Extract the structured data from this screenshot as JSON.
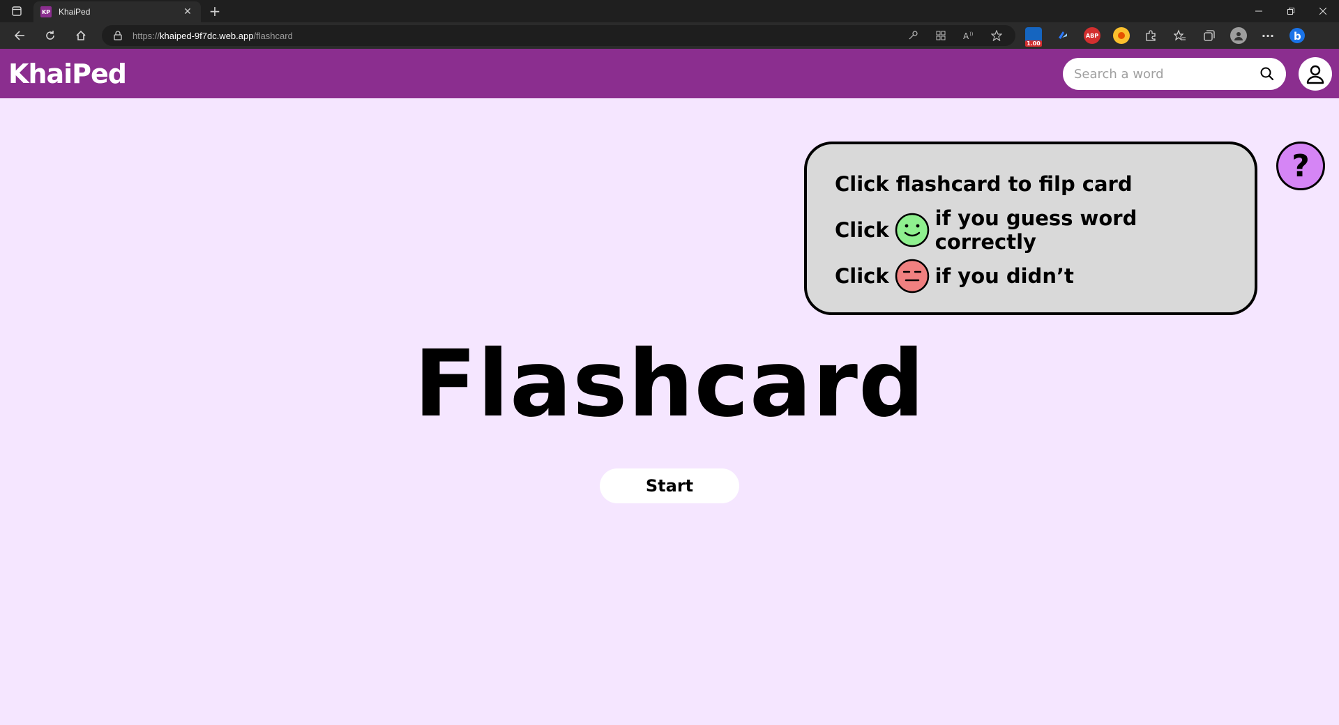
{
  "browser": {
    "tab_favicon": "KP",
    "tab_title": "KhaiPed",
    "tab_close": "✕",
    "new_tab": "+",
    "url_scheme": "https://",
    "url_host": "khaiped-9f7dc.web.app",
    "url_path": "/flashcard",
    "extension_badge": "1.00",
    "extension_abp": "ABP"
  },
  "header": {
    "logo": "KhaiPed",
    "search_placeholder": "Search a word"
  },
  "help": {
    "line1": "Click flashcard to filp card",
    "line2_prefix": "Click",
    "line2_suffix": "if you guess word correctly",
    "line3_prefix": "Click",
    "line3_suffix": "if you didn’t",
    "button_label": "?"
  },
  "main": {
    "title": "Flashcard",
    "start_label": "Start"
  },
  "colors": {
    "brand": "#8b2e8f",
    "background": "#f5e6ff",
    "help_button": "#d585f5",
    "happy_face": "#8ff08f",
    "sad_face": "#f08080"
  }
}
